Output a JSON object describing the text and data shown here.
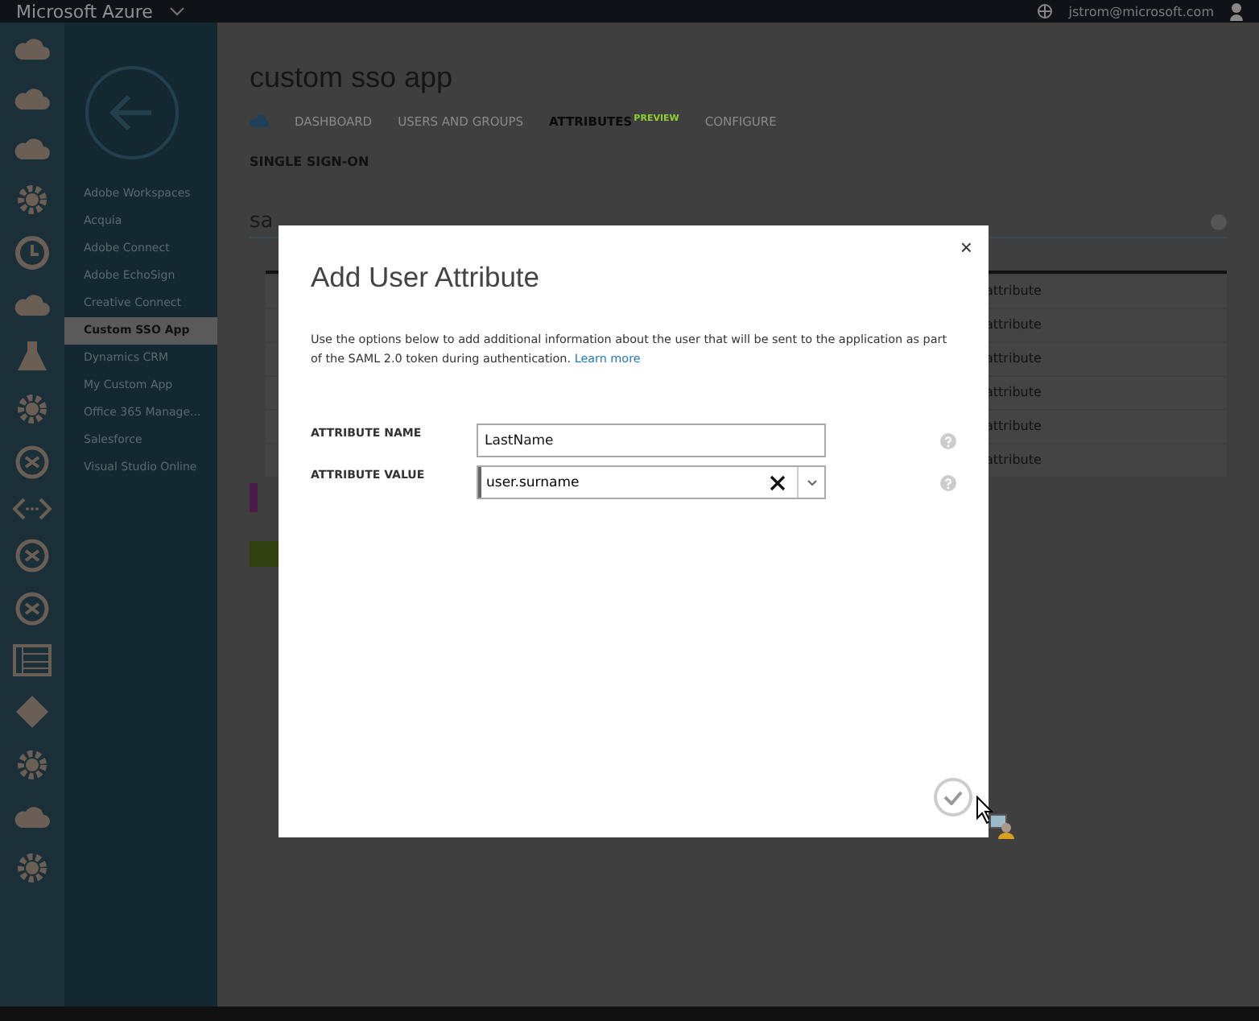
{
  "top_bar": {
    "brand": "Microsoft Azure",
    "user": "jstrom@microsoft.com"
  },
  "nav": {
    "items": [
      {
        "label": "Adobe Workspaces",
        "selected": false
      },
      {
        "label": "Acquia",
        "selected": false
      },
      {
        "label": "Adobe Connect",
        "selected": false
      },
      {
        "label": "Adobe EchoSign",
        "selected": false
      },
      {
        "label": "Creative Connect",
        "selected": false
      },
      {
        "label": "Custom SSO App",
        "selected": true
      },
      {
        "label": "Dynamics CRM",
        "selected": false
      },
      {
        "label": "My Custom App",
        "selected": false
      },
      {
        "label": "Office 365 Manage...",
        "selected": false
      },
      {
        "label": "Salesforce",
        "selected": false
      },
      {
        "label": "Visual Studio Online",
        "selected": false
      }
    ]
  },
  "page": {
    "title": "custom sso app",
    "tabs": [
      {
        "label": "DASHBOARD",
        "selected": false
      },
      {
        "label": "USERS AND GROUPS",
        "selected": false
      },
      {
        "label": "ATTRIBUTES",
        "badge": "PREVIEW",
        "selected": true
      },
      {
        "label": "CONFIGURE",
        "selected": false
      }
    ],
    "section": "SINGLE SIGN-ON",
    "table_heading": "sa",
    "rows": [
      {
        "column_2": "attribute"
      },
      {
        "column_2": "attribute"
      },
      {
        "column_2": "attribute"
      },
      {
        "column_2": "attribute"
      },
      {
        "column_2": "attribute"
      },
      {
        "column_2": "attribute"
      }
    ]
  },
  "dialog": {
    "title": "Add User Attribute",
    "close": "×",
    "description": "Use the options below to add additional information about the user that will be sent to the application as part of the SAML 2.0 token during authentication.",
    "link": "Learn more",
    "fields": [
      {
        "label": "ATTRIBUTE NAME",
        "value": "LastName",
        "kind": "text"
      },
      {
        "label": "ATTRIBUTE VALUE",
        "value": "user.surname",
        "kind": "combo"
      }
    ]
  }
}
